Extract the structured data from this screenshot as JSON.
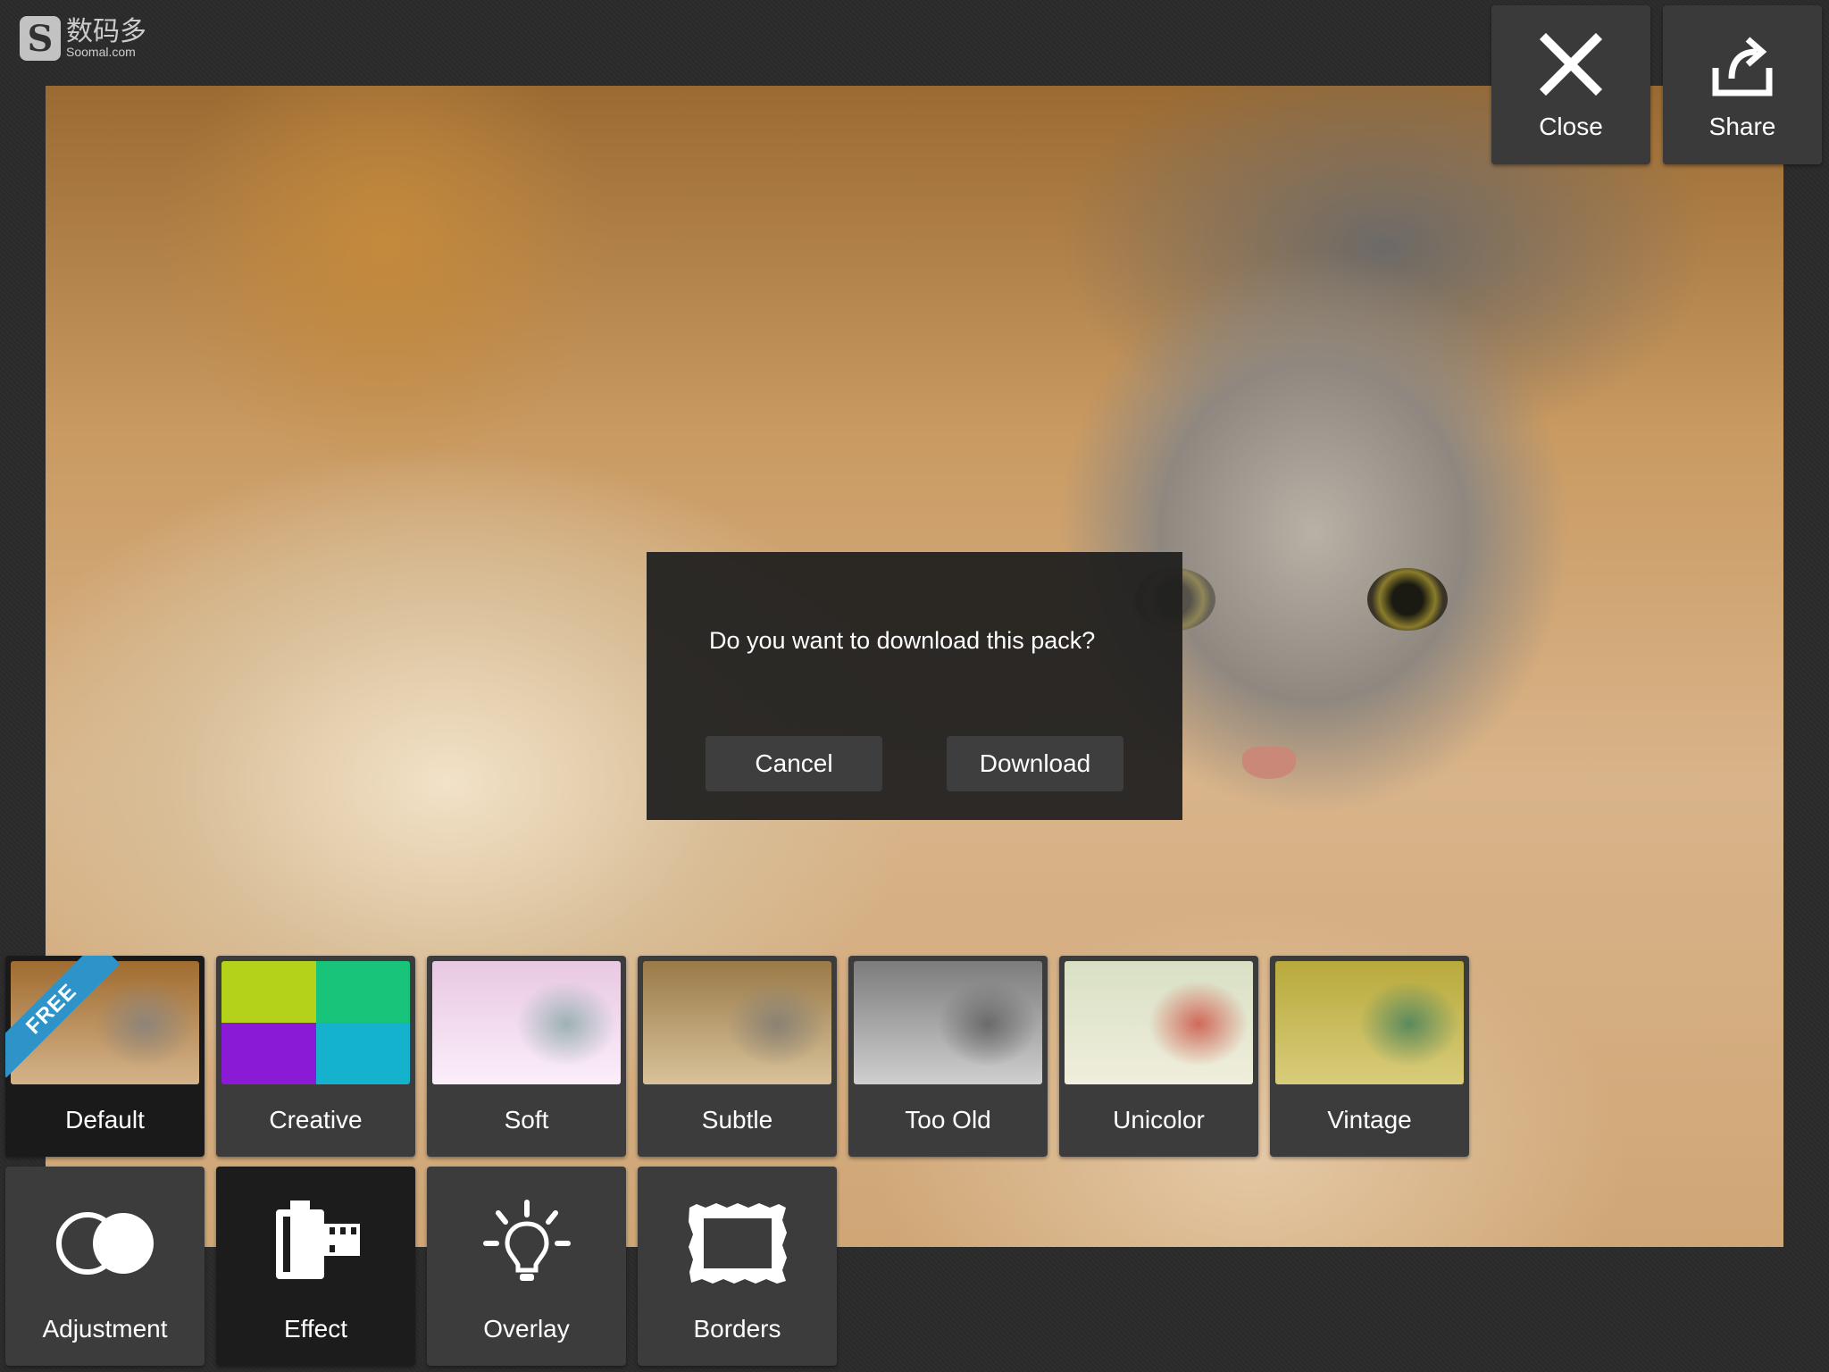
{
  "watermark": {
    "cn": "数码多",
    "en": "Soomal.com"
  },
  "top_buttons": {
    "close_label": "Close",
    "share_label": "Share"
  },
  "dialog": {
    "message": "Do you want to download this pack?",
    "cancel_label": "Cancel",
    "download_label": "Download"
  },
  "filters": {
    "free_badge": "FREE",
    "items": [
      {
        "label": "Default",
        "selected": true
      },
      {
        "label": "Creative"
      },
      {
        "label": "Soft"
      },
      {
        "label": "Subtle"
      },
      {
        "label": "Too Old"
      },
      {
        "label": "Unicolor"
      },
      {
        "label": "Vintage"
      }
    ]
  },
  "tools": {
    "items": [
      {
        "label": "Adjustment",
        "icon": "adjustment-icon"
      },
      {
        "label": "Effect",
        "icon": "film-canister-icon",
        "selected": true
      },
      {
        "label": "Overlay",
        "icon": "lightbulb-icon"
      },
      {
        "label": "Borders",
        "icon": "frame-border-icon"
      }
    ]
  }
}
